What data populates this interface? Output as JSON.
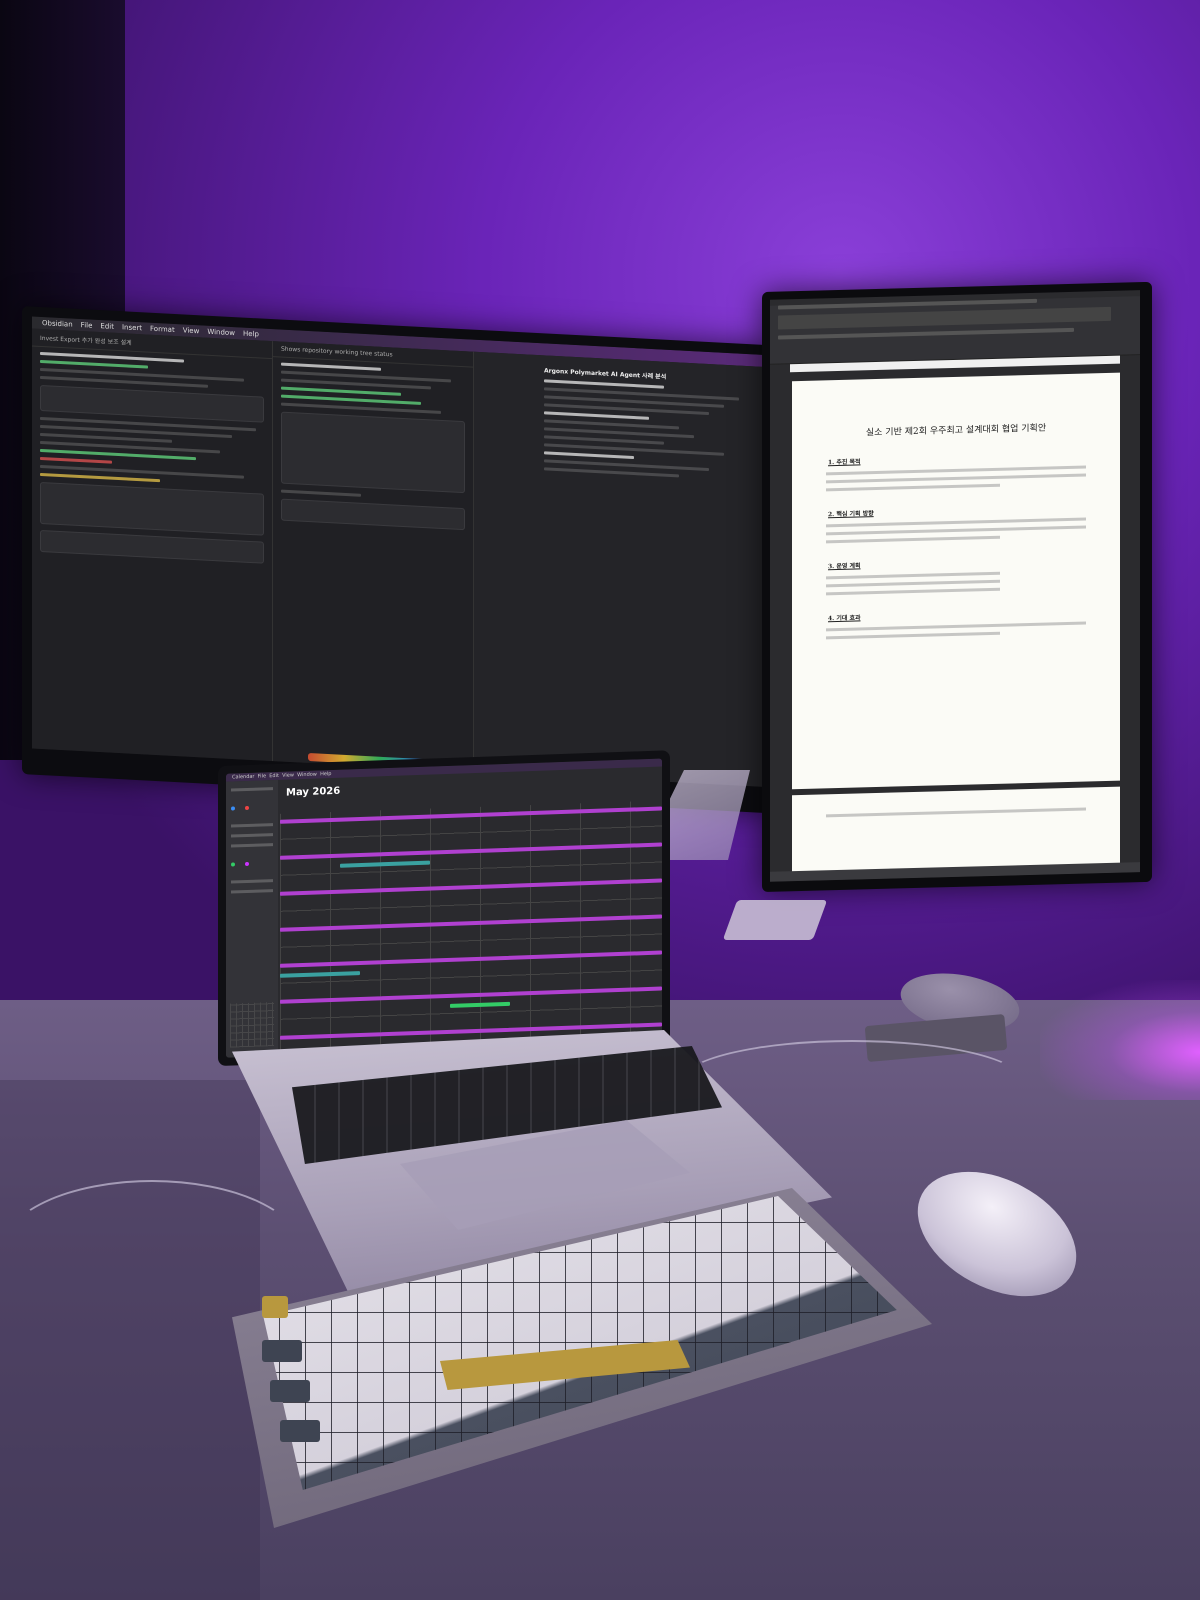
{
  "scene": {
    "main_monitor": {
      "menu_items": [
        "Obsidian",
        "File",
        "Edit",
        "Insert",
        "Format",
        "View",
        "Window",
        "Help"
      ],
      "left_pane_title": "Invest Export 추가 완성 보조 설계",
      "mid_pane_title": "Shows repository working tree status",
      "right_pane_doc_title": "Argonx Polymarket AI Agent 사례 분석"
    },
    "vertical_monitor": {
      "doc_heading": "실소 기반 제2회 우주최고 설계대회 협업 기획안",
      "sections": [
        "1. 추진 목적",
        "2. 핵심 기획 방향",
        "3. 운영 계획",
        "4. 기대 효과"
      ]
    },
    "laptop": {
      "calendar_title": "May 2026",
      "menu_items": [
        "Calendar",
        "File",
        "Edit",
        "View",
        "Window",
        "Help"
      ]
    }
  }
}
